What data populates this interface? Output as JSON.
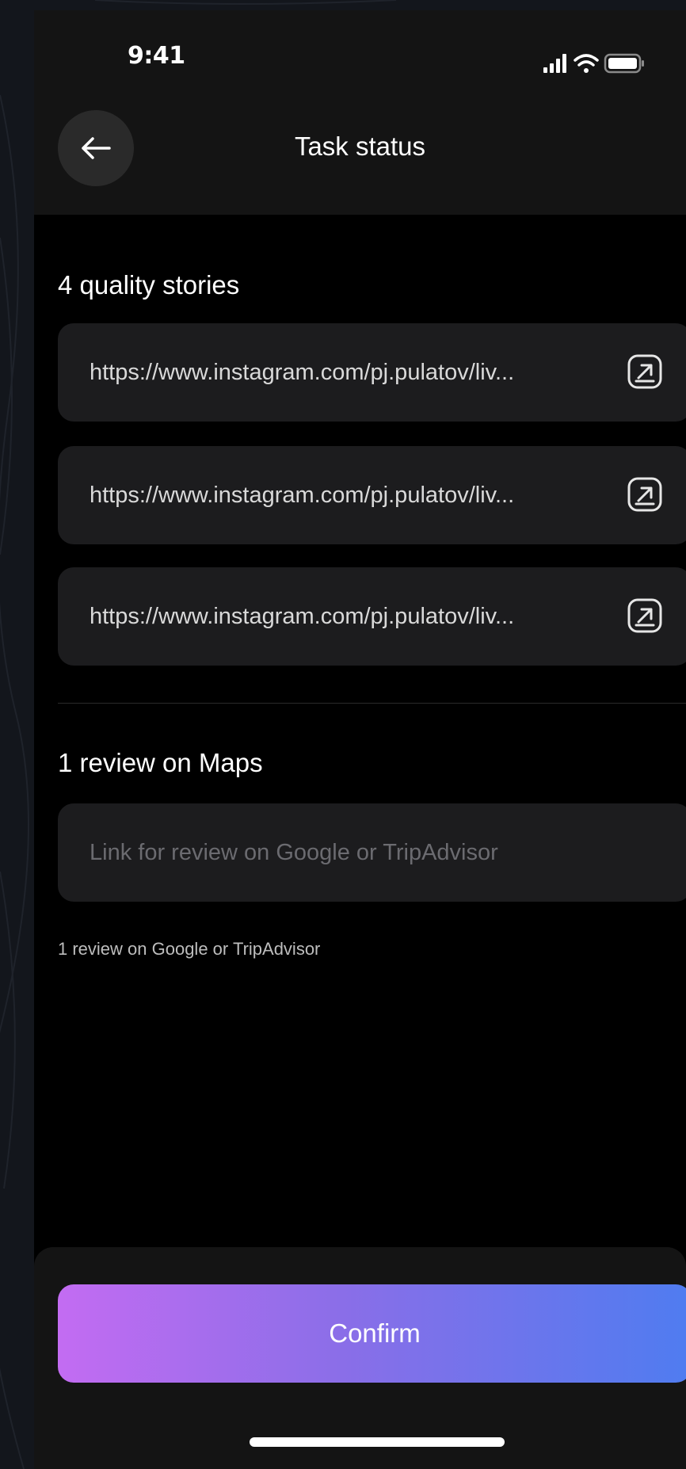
{
  "status_bar": {
    "time": "9:41",
    "icons": [
      "signal-icon",
      "wifi-icon",
      "battery-icon"
    ]
  },
  "header": {
    "back_icon": "arrow-left-icon",
    "title": "Task status"
  },
  "stories": {
    "title": "4 quality stories",
    "links": [
      "https://www.instagram.com/pj.pulatov/liv...",
      "https://www.instagram.com/pj.pulatov/liv...",
      "https://www.instagram.com/pj.pulatov/liv..."
    ],
    "open_icon": "external-link-icon"
  },
  "review": {
    "title": "1 review on Maps",
    "placeholder": "Link for review on Google or TripAdvisor",
    "value": "",
    "helper": "1 review on Google or TripAdvisor"
  },
  "footer": {
    "confirm_label": "Confirm"
  },
  "colors": {
    "background": "#000000",
    "card": "#1c1c1e",
    "gradient_start": "#c36cf2",
    "gradient_end": "#4f7cf0"
  }
}
